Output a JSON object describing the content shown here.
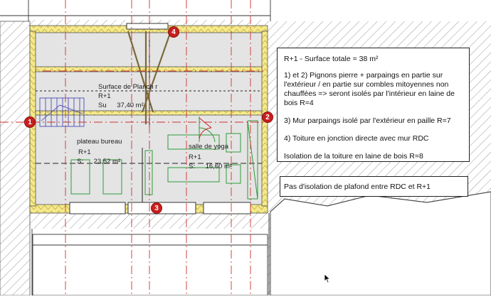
{
  "colors": {
    "marker": "#c81e1e",
    "insulation": "#f5e98a",
    "furniture": "#2e9b3a",
    "axis_dash": "#d03030",
    "hatch": "#9a9a9a",
    "floor": "#e4e4e4"
  },
  "markers": [
    "1",
    "2",
    "3",
    "4"
  ],
  "rooms": [
    {
      "name": "Surface de Planch r",
      "level": "R+1",
      "area_prefix": "Su",
      "area": "37,40 m²"
    },
    {
      "name": "plateau bureau",
      "level": "R+1",
      "area_prefix": "S:",
      "area": "23,52 m²"
    },
    {
      "name": "salle de yoga",
      "level": "R+1",
      "area_prefix": "S:",
      "area": "16,60 m²"
    }
  ],
  "notes": {
    "main": [
      "R+1 - Surface totale = 38 m²",
      "1) et 2) Pignons pierre + parpaings en partie sur l'extérieur / en partie sur combles mitoyennes non chauffées => seront isolés par l'intérieur en laine de bois  R=4",
      "3) Mur parpaings isolé par l'extérieur en paille R=7",
      "4) Toiture en jonction directe avec mur RDC",
      "Isolation de la toiture en laine de bois R=8"
    ],
    "secondary": "Pas d'isolation de plafond entre RDC et R+1"
  },
  "icons": [
    "cursor-arrow-icon",
    "stair-icon",
    "door-swing-icon"
  ]
}
